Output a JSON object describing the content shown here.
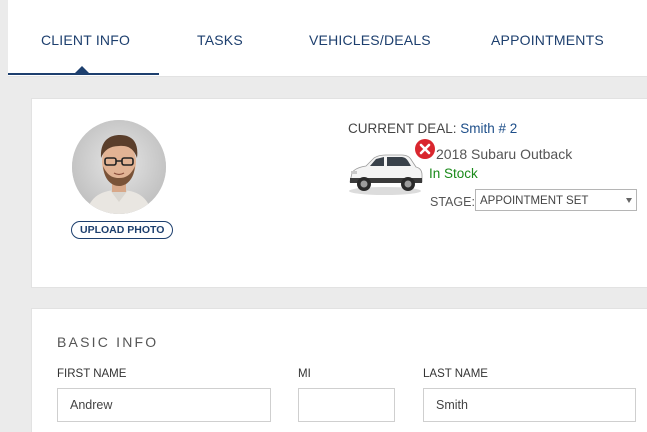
{
  "tabs": [
    {
      "label": "CLIENT INFO",
      "active": true
    },
    {
      "label": "TASKS",
      "active": false
    },
    {
      "label": "VEHICLES/DEALS",
      "active": false
    },
    {
      "label": "APPOINTMENTS",
      "active": false
    }
  ],
  "client": {
    "upload_photo_label": "UPLOAD PHOTO",
    "avatar_icon": "person-photo"
  },
  "deal": {
    "label": "CURRENT DEAL: ",
    "name": "Smith # 2",
    "vehicle": "2018 Subaru Outback",
    "stock_status": "In Stock",
    "stage_label": "STAGE:",
    "stage_value": "APPOINTMENT SET",
    "remove_icon": "close-circle-icon"
  },
  "basic_info": {
    "title": "BASIC INFO",
    "fields": [
      {
        "label": "FIRST NAME",
        "value": "Andrew"
      },
      {
        "label": "MI",
        "value": ""
      },
      {
        "label": "LAST NAME",
        "value": "Smith"
      }
    ]
  },
  "colors": {
    "primary": "#1d3f6e",
    "link": "#1d4e89",
    "in_stock": "#1a8a1a",
    "remove": "#d9262e",
    "background": "#ebebeb"
  }
}
